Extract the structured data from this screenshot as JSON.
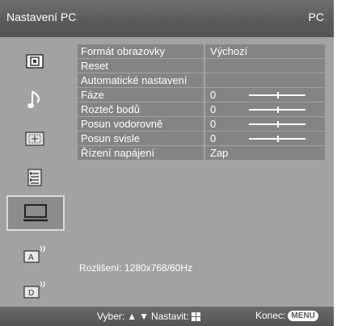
{
  "header": {
    "title": "Nastavení PC",
    "mode": "PC"
  },
  "sidebar": {
    "items": [
      {
        "icon": "picture-icon"
      },
      {
        "icon": "sound-note-icon"
      },
      {
        "icon": "screen-adjust-icon"
      },
      {
        "icon": "settings-list-icon"
      },
      {
        "icon": "pc-monitor-icon",
        "active": true
      },
      {
        "icon": "input-a-icon"
      },
      {
        "icon": "input-d-icon"
      }
    ]
  },
  "menu": {
    "rows": [
      {
        "label": "Formát obrazovky",
        "value": "Výchozí"
      },
      {
        "label": "Reset",
        "value": ""
      },
      {
        "label": "Automatické nastavení",
        "value": ""
      },
      {
        "label": "Fáze",
        "value": "0",
        "slider": 0.5
      },
      {
        "label": "Rozteč bodů",
        "value": "0",
        "slider": 0.5
      },
      {
        "label": "Posun vodorovně",
        "value": "0",
        "slider": 0.5
      },
      {
        "label": "Posun svisle",
        "value": "0",
        "slider": 0.5
      },
      {
        "label": "Řízení napájení",
        "value": "Zap"
      }
    ]
  },
  "status": {
    "resolution": "Rozlišení: 1280x768/60Hz"
  },
  "footer": {
    "select_label": "Vyber:",
    "set_label": "Nastavit:",
    "exit_label": "Konec:",
    "menu_button": "MENU"
  },
  "colors": {
    "background": "#a2a2a2",
    "row": "#848484",
    "header": "#5b5b5b",
    "text": "#ffffff"
  }
}
